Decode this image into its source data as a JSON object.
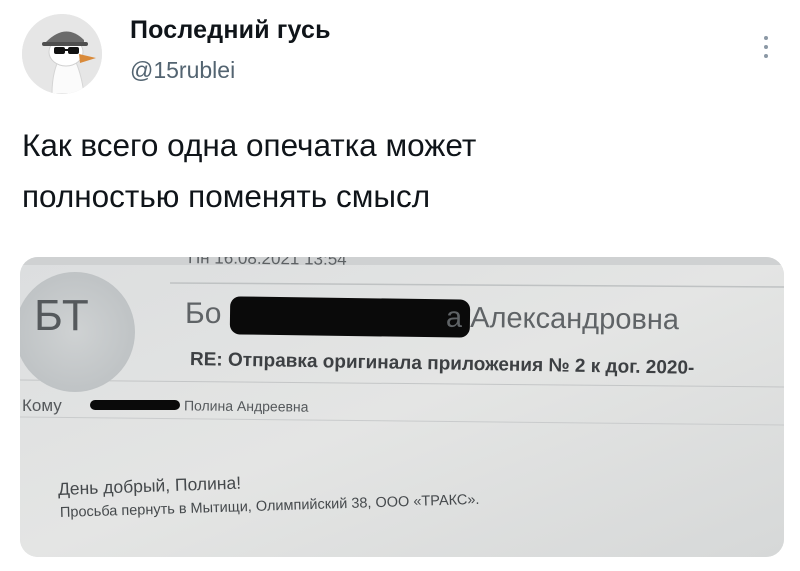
{
  "tweet": {
    "author_name": "Последний гусь",
    "author_handle": "@15rublei",
    "text_lines": [
      "Как всего одна опечатка может",
      "полностью поменять смысл"
    ]
  },
  "icons": {
    "avatar": "goose-with-sunglasses-avatar",
    "more": "more-vertical-icon"
  },
  "photo": {
    "date": "Пн 16.08.2021 13:54",
    "avatar_initials": "БТ",
    "sender_start": "Бо",
    "sender_end": "а Александровна",
    "subject": "RE: Отправка оригинала приложения № 2 к дог. 2020-",
    "to_label": "Кому",
    "recipient": "Полина Андреевна",
    "greeting": "День добрый, Полина!",
    "body": "Просьба пернуть в Мытищи, Олимпийский 38, ООО «ТРАКС»."
  }
}
